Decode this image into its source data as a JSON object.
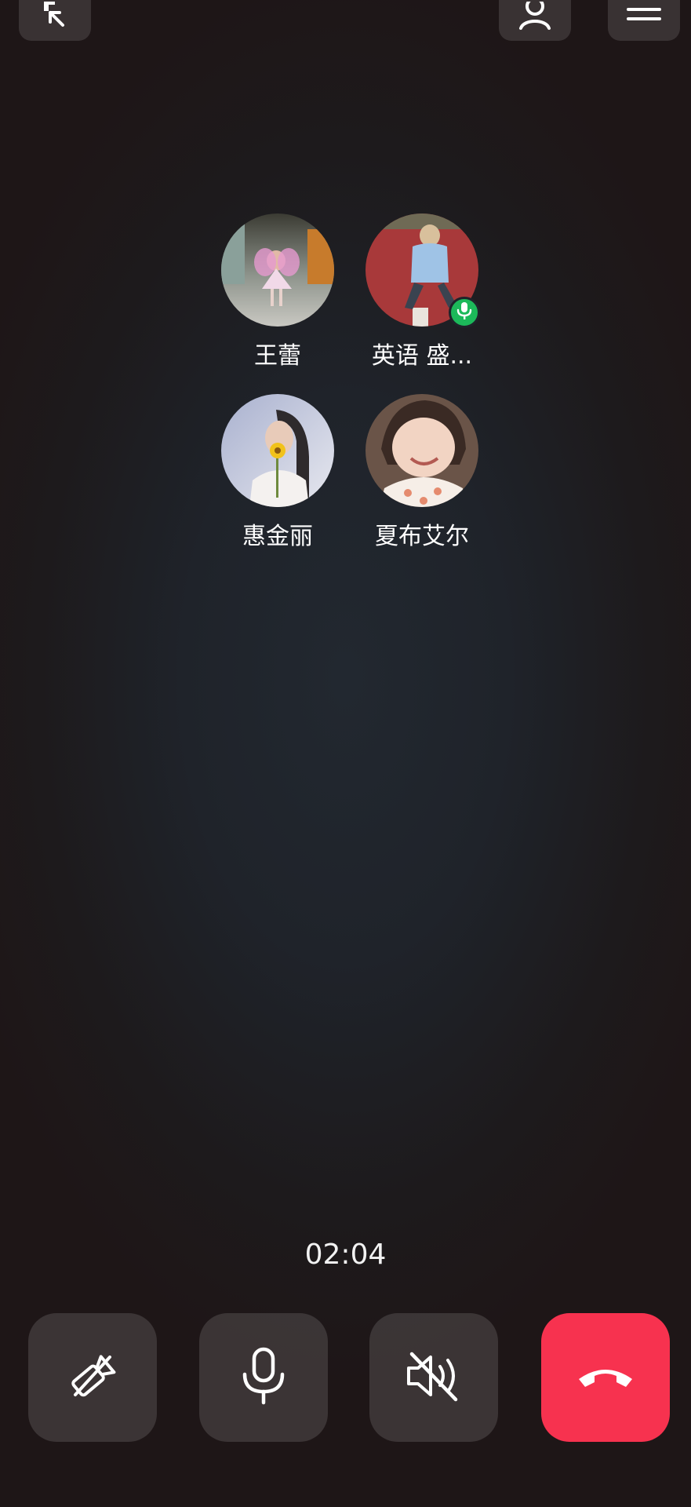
{
  "participants": [
    {
      "name": "王蕾",
      "speaking": false
    },
    {
      "name": "英语 盛...",
      "speaking": true
    },
    {
      "name": "惠金丽",
      "speaking": false
    },
    {
      "name": "夏布艾尔",
      "speaking": false
    }
  ],
  "call": {
    "duration": "02:04"
  },
  "icons": {
    "minimize": "minimize-arrow-icon",
    "add_member": "add-person-icon",
    "menu": "menu-icon",
    "camera": "camera-off-icon",
    "mic": "microphone-icon",
    "speaker": "speaker-off-icon",
    "hangup": "hang-up-icon"
  },
  "colors": {
    "hangup": "#f7324f",
    "speaking_badge": "#1cb95a"
  }
}
